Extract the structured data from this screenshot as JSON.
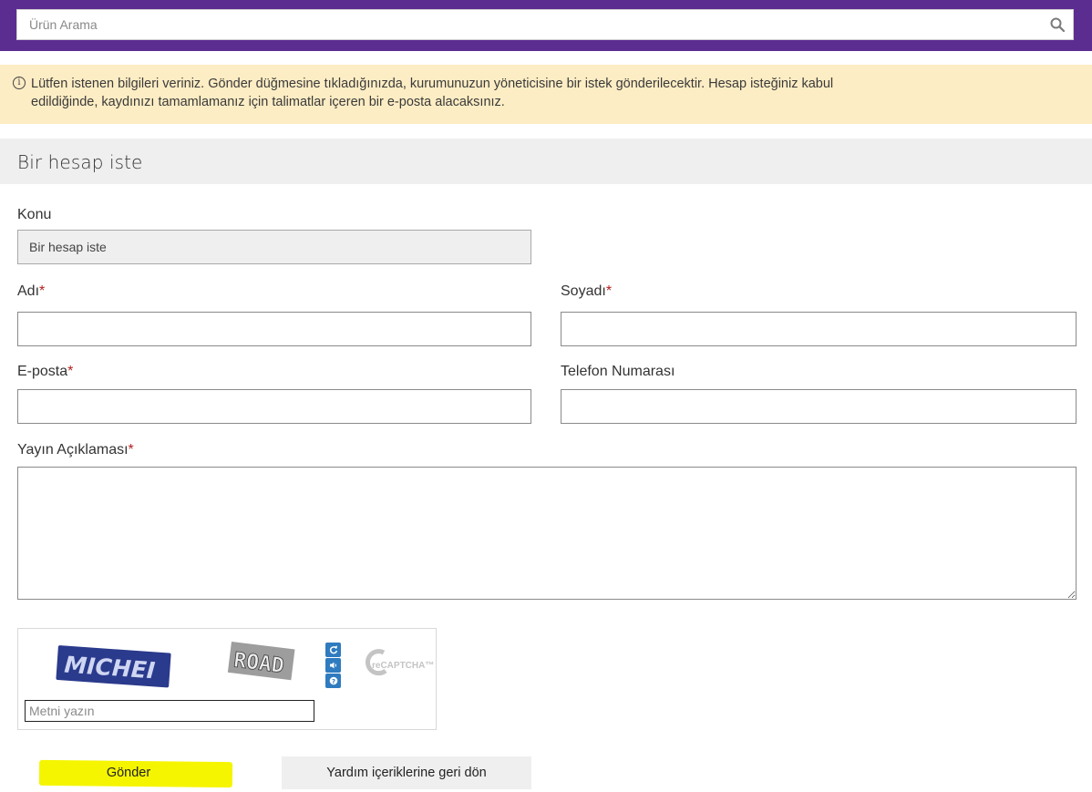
{
  "search": {
    "placeholder": "Ürün Arama",
    "icon": "search-icon"
  },
  "alert": {
    "icon": "info-icon",
    "line1": "Lütfen istenen bilgileri veriniz. Gönder düğmesine tıkladığınızda, kurumunuzun yöneticisine bir istek gönderilecektir. Hesap isteğiniz kabul",
    "line2": "edildiğinde, kaydınızı tamamlamanız için talimatlar içeren bir e-posta alacaksınız.",
    "background": "#fdedc4"
  },
  "header": {
    "title": "Bir hesap iste",
    "brand_color": "#5c2d91"
  },
  "form": {
    "subject_label": "Konu",
    "subject_value": "Bir hesap iste",
    "first_name_label": "Adı",
    "last_name_label": "Soyadı",
    "email_label": "E-posta",
    "phone_label": "Telefon Numarası",
    "description_label": "Yayın Açıklaması",
    "required_mark": "*"
  },
  "captcha": {
    "word1": "MICHEI",
    "word2": "ROAD",
    "input_placeholder": "Metni yazın",
    "logo_text": "reCAPTCHA™",
    "icons": [
      "refresh-icon",
      "audio-icon",
      "help-icon"
    ]
  },
  "buttons": {
    "submit": "Gönder",
    "back": "Yardım içeriklerine geri dön",
    "highlight_color": "#f5f500"
  }
}
